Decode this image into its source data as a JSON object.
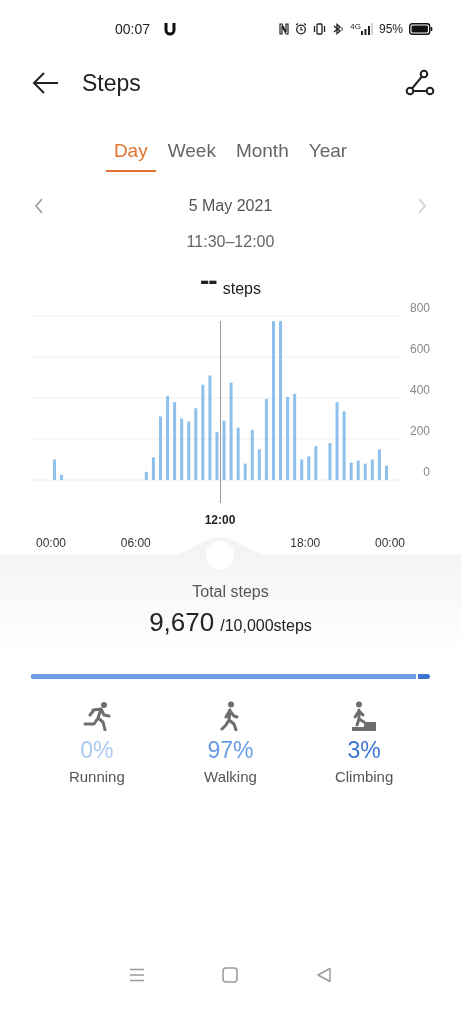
{
  "status_bar": {
    "time": "00:07",
    "network": "4G",
    "battery": "95%"
  },
  "header": {
    "title": "Steps"
  },
  "tabs": [
    {
      "label": "Day",
      "selected": true
    },
    {
      "label": "Week",
      "selected": false
    },
    {
      "label": "Month",
      "selected": false
    },
    {
      "label": "Year",
      "selected": false
    }
  ],
  "date_nav": {
    "date": "5 May 2021",
    "prev_disabled": false,
    "next_disabled": true
  },
  "selection": {
    "range": "11:30–12:00",
    "value": "--",
    "unit": "steps",
    "cursor_label": "12:00"
  },
  "chart": {
    "chart_data": {
      "type": "bar",
      "x": [
        0.25,
        0.75,
        1.25,
        1.75,
        2.25,
        2.75,
        3.25,
        3.75,
        4.25,
        4.75,
        5.25,
        5.75,
        6.25,
        6.75,
        7.25,
        7.75,
        8.25,
        8.75,
        9.25,
        9.75,
        10.25,
        10.75,
        11.25,
        11.75,
        12.25,
        12.75,
        13.25,
        13.75,
        14.25,
        14.75,
        15.25,
        15.75,
        16.25,
        16.75,
        17.25,
        17.75,
        18.25,
        18.75,
        19.25,
        19.75,
        20.25,
        20.75,
        21.25,
        21.75,
        22.25,
        22.75,
        23.25,
        23.75
      ],
      "values": [
        100,
        25,
        0,
        0,
        0,
        0,
        0,
        0,
        0,
        0,
        0,
        0,
        0,
        40,
        110,
        310,
        410,
        380,
        300,
        285,
        350,
        465,
        510,
        235,
        290,
        475,
        255,
        80,
        245,
        150,
        395,
        775,
        775,
        405,
        420,
        100,
        115,
        165,
        0,
        180,
        380,
        335,
        85,
        95,
        80,
        100,
        150,
        70
      ],
      "xlim": [
        0,
        24
      ],
      "ylim": [
        0,
        800
      ],
      "xticks": [
        {
          "value": 0,
          "label": "00:00"
        },
        {
          "value": 6,
          "label": "06:00"
        },
        {
          "value": 18,
          "label": "18:00"
        },
        {
          "value": 24,
          "label": "00:00"
        }
      ],
      "yticks": [
        0,
        200,
        400,
        600,
        800
      ],
      "grid": true
    }
  },
  "summary": {
    "label": "Total steps",
    "total": "9,670",
    "goal": "/10,000steps"
  },
  "share_bar": {
    "level": 0.97
  },
  "activities": [
    {
      "kind": "running",
      "percent": "0%",
      "label": "Running",
      "color": "#a9c9f0"
    },
    {
      "kind": "walking",
      "percent": "97%",
      "label": "Walking",
      "color": "#6b9ce6"
    },
    {
      "kind": "climbing",
      "percent": "3%",
      "label": "Climbing",
      "color": "#3d74d4"
    }
  ]
}
